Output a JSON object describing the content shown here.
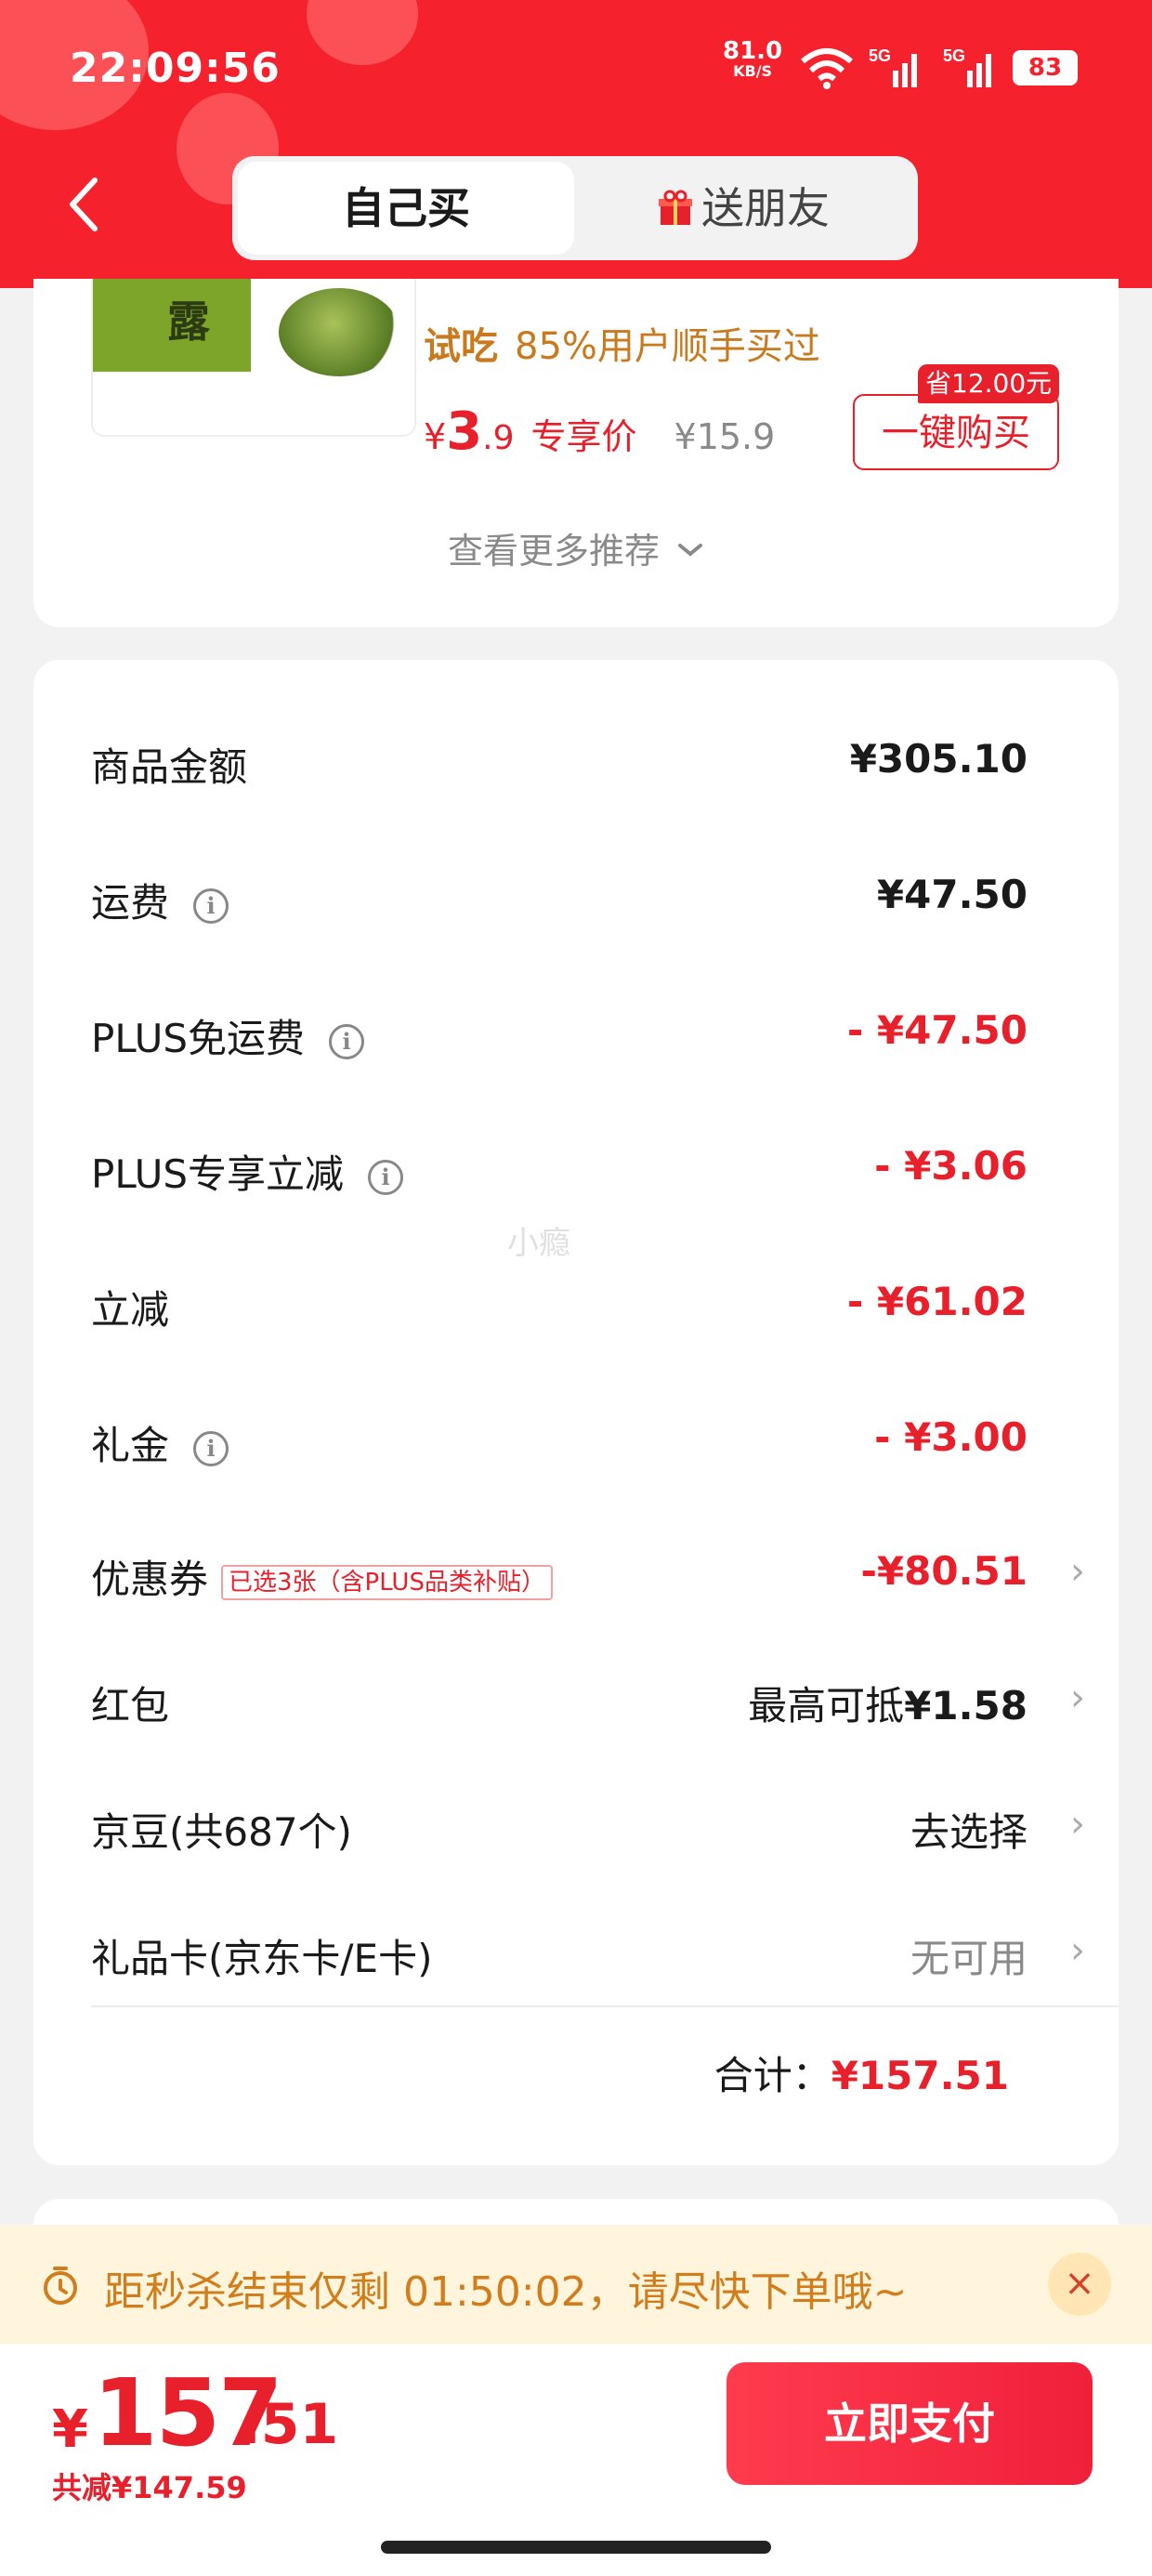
{
  "status_bar": {
    "time": "22:09:56",
    "speed_value": "81.0",
    "speed_unit": "KB/S",
    "network_1": "5G",
    "network_2": "5G",
    "battery": "83"
  },
  "header": {
    "tab_self": "自己买",
    "tab_gift": "送朋友",
    "gift_icon": "gift-icon",
    "back_icon": "chevron-left-icon",
    "brand_color": "#f5222d"
  },
  "recommend": {
    "product_image_text": "露",
    "try_label": "试吃",
    "try_text": "85%用户顺手买过",
    "price_symbol": "¥",
    "price_int": "3",
    "price_dec": ".9",
    "price_tag": "专享价",
    "original_price": "¥15.9",
    "save_badge": "省12.00元",
    "buy_button": "一键购买",
    "more_link": "查看更多推荐",
    "more_icon": "chevron-down-icon"
  },
  "summary": {
    "rows": [
      {
        "label": "商品金额",
        "value": "¥305.10"
      },
      {
        "label": "运费",
        "value": "¥47.50"
      },
      {
        "label": "PLUS免运费",
        "value": "- ¥47.50"
      },
      {
        "label": "PLUS专享立减",
        "value": "- ¥3.06"
      },
      {
        "label": "立减",
        "value": "- ¥61.02"
      },
      {
        "label": "礼金",
        "value": "- ¥3.00"
      },
      {
        "label": "优惠券",
        "tag": "已选3张（含PLUS品类补贴）",
        "value": "-¥80.51"
      },
      {
        "label": "红包",
        "value_prefix": "最高可抵",
        "value": "¥1.58"
      },
      {
        "label": "京豆(共687个)",
        "value": "去选择"
      },
      {
        "label": "礼品卡(京东卡/E卡)",
        "value": "无可用"
      }
    ],
    "info_icon_char": "i",
    "chevron_char": "›",
    "watermark": "小瘾",
    "total_label": "合计：",
    "total_value": "¥157.51"
  },
  "flash_sale": {
    "text": "距秒杀结束仅剩 01:50:02，请尽快下单哦~",
    "close_char": "×",
    "icon": "timer-icon"
  },
  "footer": {
    "currency": "¥",
    "total_int": "157",
    "total_dec": ".51",
    "saved": "共减¥147.59",
    "pay_button": "立即支付"
  },
  "colors": {
    "price_red": "#e8202b",
    "accent_gold": "#c87a1e",
    "banner_bg": "#fff5dc"
  }
}
